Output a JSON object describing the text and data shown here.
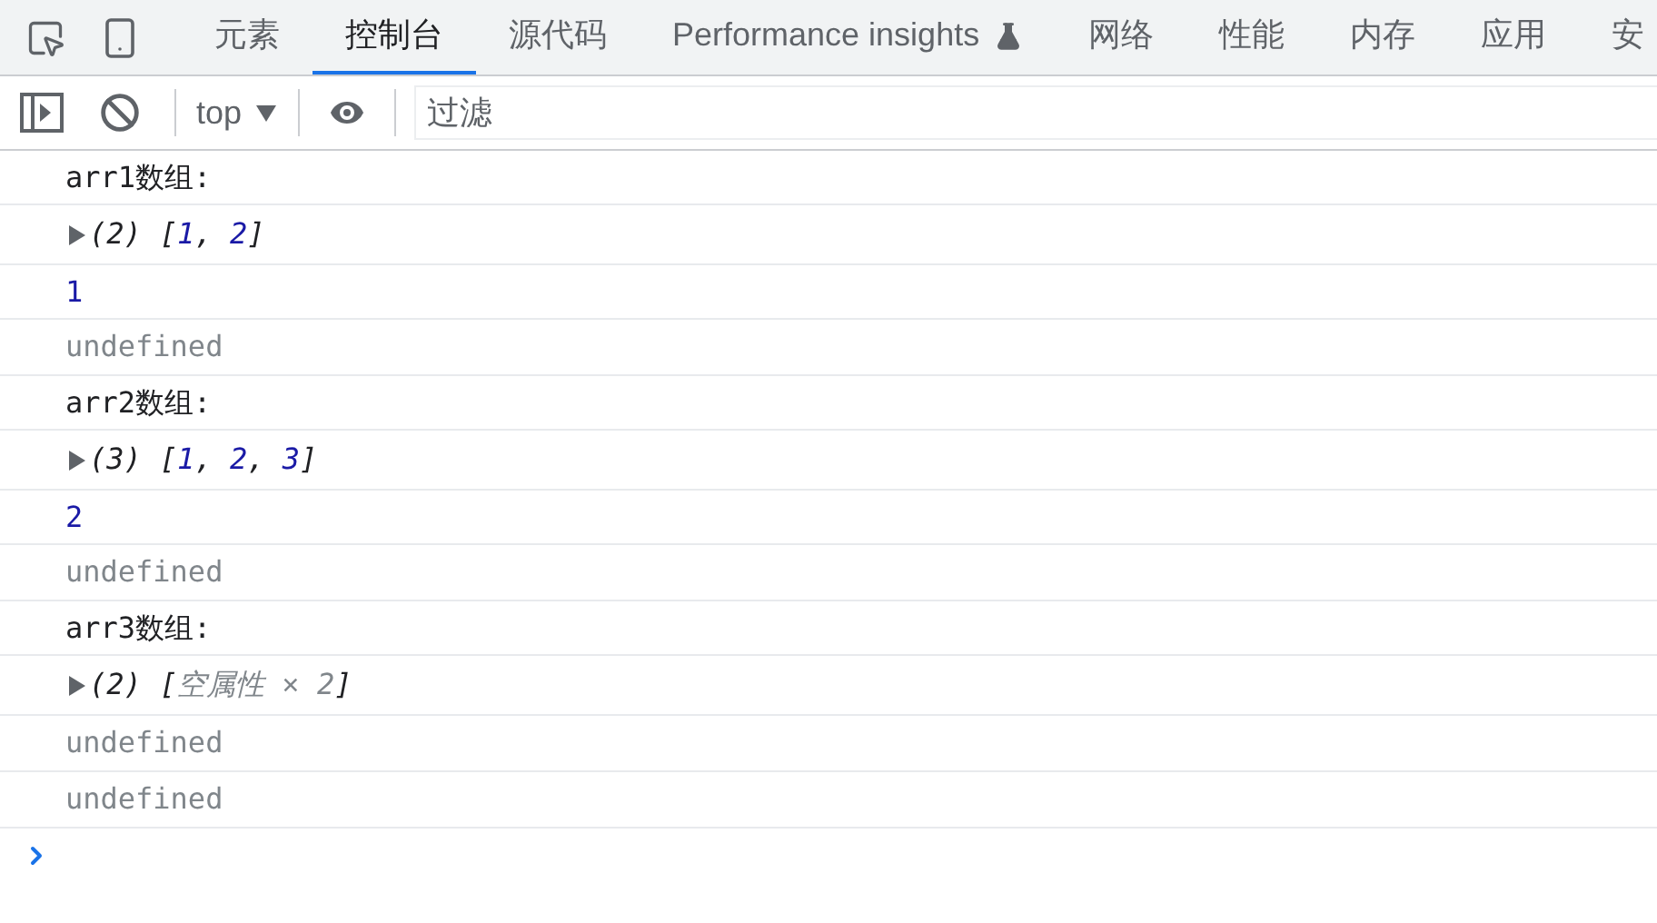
{
  "tabs": [
    {
      "label": "元素",
      "selected": false
    },
    {
      "label": "控制台",
      "selected": true
    },
    {
      "label": "源代码",
      "selected": false
    },
    {
      "label": "Performance insights",
      "selected": false,
      "experimental": true
    },
    {
      "label": "网络",
      "selected": false
    },
    {
      "label": "性能",
      "selected": false
    },
    {
      "label": "内存",
      "selected": false
    },
    {
      "label": "应用",
      "selected": false
    },
    {
      "label": "安",
      "selected": false
    }
  ],
  "toolbar": {
    "context": "top",
    "filter": {
      "placeholder": "过滤"
    }
  },
  "console": [
    {
      "kind": "log",
      "text": "arr1数组:"
    },
    {
      "kind": "array",
      "count": "(2)",
      "preview": [
        {
          "kind": "punct",
          "text": "["
        },
        {
          "kind": "number",
          "text": "1"
        },
        {
          "kind": "punct",
          "text": ", "
        },
        {
          "kind": "number",
          "text": "2"
        },
        {
          "kind": "punct",
          "text": "]"
        }
      ]
    },
    {
      "kind": "number",
      "text": "1"
    },
    {
      "kind": "undefined",
      "text": "undefined"
    },
    {
      "kind": "log",
      "text": "arr2数组:"
    },
    {
      "kind": "array",
      "count": "(3)",
      "preview": [
        {
          "kind": "punct",
          "text": "["
        },
        {
          "kind": "number",
          "text": "1"
        },
        {
          "kind": "punct",
          "text": ", "
        },
        {
          "kind": "number",
          "text": "2"
        },
        {
          "kind": "punct",
          "text": ", "
        },
        {
          "kind": "number",
          "text": "3"
        },
        {
          "kind": "punct",
          "text": "]"
        }
      ]
    },
    {
      "kind": "number",
      "text": "2"
    },
    {
      "kind": "undefined",
      "text": "undefined"
    },
    {
      "kind": "log",
      "text": "arr3数组:"
    },
    {
      "kind": "array",
      "count": "(2)",
      "preview": [
        {
          "kind": "punct",
          "text": "["
        },
        {
          "kind": "empty",
          "text": "空属性 × 2"
        },
        {
          "kind": "punct",
          "text": "]"
        }
      ]
    },
    {
      "kind": "undefined",
      "text": "undefined"
    },
    {
      "kind": "undefined",
      "text": "undefined"
    }
  ]
}
